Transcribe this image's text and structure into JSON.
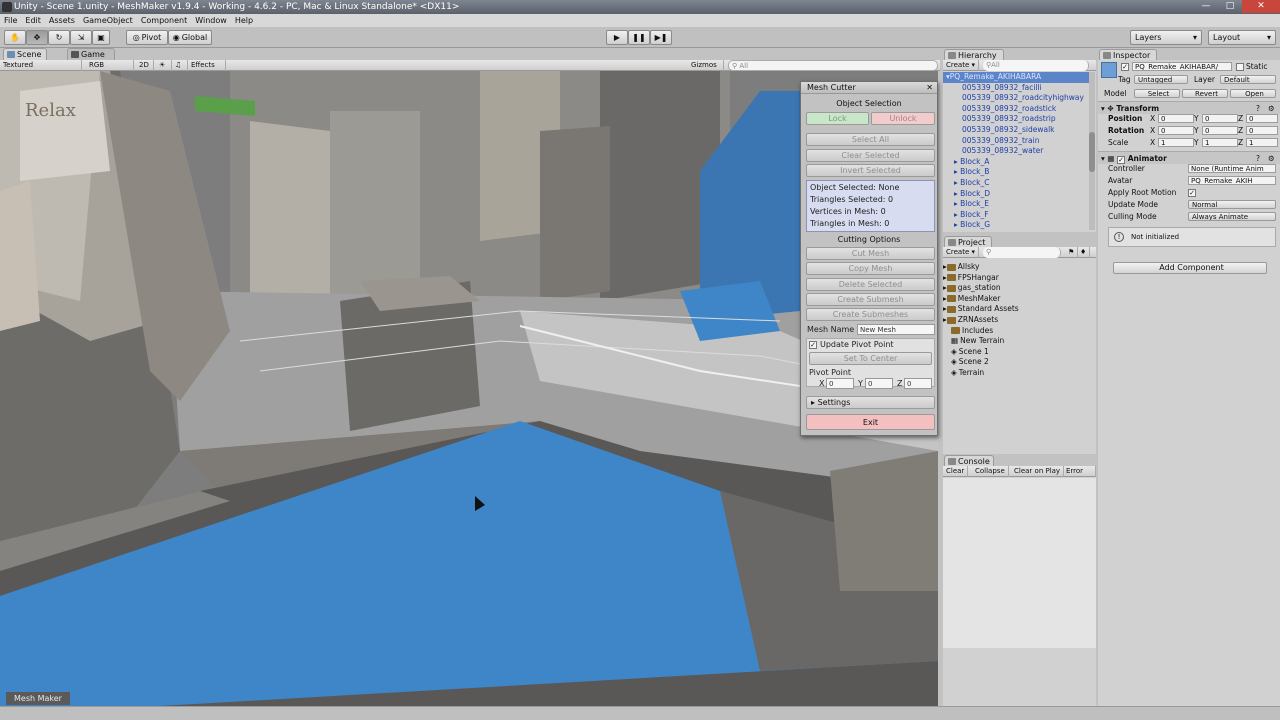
{
  "window": {
    "title": "Unity - Scene 1.unity - MeshMaker v1.9.4 - Working - 4.6.2 - PC, Mac & Linux Standalone* <DX11>"
  },
  "menu": [
    "File",
    "Edit",
    "Assets",
    "GameObject",
    "Component",
    "Window",
    "Help"
  ],
  "toolbar": {
    "pivot": "Pivot",
    "global": "Global",
    "layers": "Layers",
    "layout": "Layout"
  },
  "scene": {
    "tab_scene": "Scene",
    "tab_game": "Game",
    "shading": "Textured",
    "rgb": "RGB",
    "mode2d": "2D",
    "effects": "Effects",
    "gizmos": "Gizmos",
    "search": "All"
  },
  "mesh_cutter": {
    "title": "Mesh Cutter",
    "object_selection": "Object Selection",
    "lock": "Lock",
    "unlock": "Unlock",
    "select_all": "Select All",
    "clear_selected": "Clear Selected",
    "invert_selected": "Invert Selected",
    "info": [
      "Object Selected: None",
      "Triangles Selected: 0",
      "Vertices in Mesh: 0",
      "Triangles in Mesh: 0"
    ],
    "cutting_options": "Cutting Options",
    "cut_mesh": "Cut Mesh",
    "copy_mesh": "Copy Mesh",
    "delete_selected": "Delete Selected",
    "create_submesh": "Create Submesh",
    "create_submeshes": "Create Submeshes",
    "mesh_name_label": "Mesh Name",
    "mesh_name_value": "New Mesh",
    "update_pivot": "Update Pivot Point",
    "set_to_center": "Set To Center",
    "pivot_point": "Pivot Point",
    "px": "X",
    "py": "Y",
    "pz": "Z",
    "pxv": "0",
    "pyv": "0",
    "pzv": "0",
    "settings": "Settings",
    "exit": "Exit"
  },
  "hierarchy": {
    "tab": "Hierarchy",
    "create": "Create",
    "search": "All",
    "items": [
      "PQ_Remake_AKIHABARA",
      "005339_08932_facilli",
      "005339_08932_roadcityhighway",
      "005339_08932_roadstick",
      "005339_08932_roadstrip",
      "005339_08932_sidewalk",
      "005339_08932_train",
      "005339_08932_water",
      "Block_A",
      "Block_B",
      "Block_C",
      "Block_D",
      "Block_E",
      "Block_F",
      "Block_G"
    ]
  },
  "project": {
    "tab": "Project",
    "create": "Create",
    "items": [
      "Allsky",
      "FPSHangar",
      "gas_station",
      "MeshMaker",
      "Standard Assets",
      "ZRNAssets",
      "Includes",
      "New Terrain",
      "Scene 1",
      "Scene 2",
      "Terrain"
    ]
  },
  "console": {
    "tab": "Console",
    "clear": "Clear",
    "collapse": "Collapse",
    "clear_on_play": "Clear on Play",
    "error_pause": "Error Pau"
  },
  "inspector": {
    "tab": "Inspector",
    "object_name": "PQ_Remake_AKIHABAR/",
    "static": "Static",
    "tag_label": "Tag",
    "tag_value": "Untagged",
    "layer_label": "Layer",
    "layer_value": "Default",
    "model_label": "Model",
    "select": "Select",
    "revert": "Revert",
    "open": "Open",
    "transform": "Transform",
    "position": "Position",
    "rotation": "Rotation",
    "scale": "Scale",
    "ax_x": "X",
    "ax_y": "Y",
    "ax_z": "Z",
    "pos": [
      "0",
      "0",
      "0"
    ],
    "rot": [
      "0",
      "0",
      "0"
    ],
    "scl": [
      "1",
      "1",
      "1"
    ],
    "animator": "Animator",
    "controller_label": "Controller",
    "controller_value": "None (Runtime Anim",
    "avatar_label": "Avatar",
    "avatar_value": "PQ_Remake_AKIH",
    "apply_root_label": "Apply Root Motion",
    "update_mode_label": "Update Mode",
    "update_mode_value": "Normal",
    "culling_label": "Culling Mode",
    "culling_value": "Always Animate",
    "not_initialized": "Not initialized",
    "add_component": "Add Component"
  },
  "status": {
    "tag": "Mesh Maker"
  },
  "colors": {
    "water": "#3f86c8",
    "exit_button": "#f3bfbf",
    "lock_button": "#c9e6c9",
    "unlock_button": "#f2cccc",
    "selection": "#5c84c9"
  }
}
